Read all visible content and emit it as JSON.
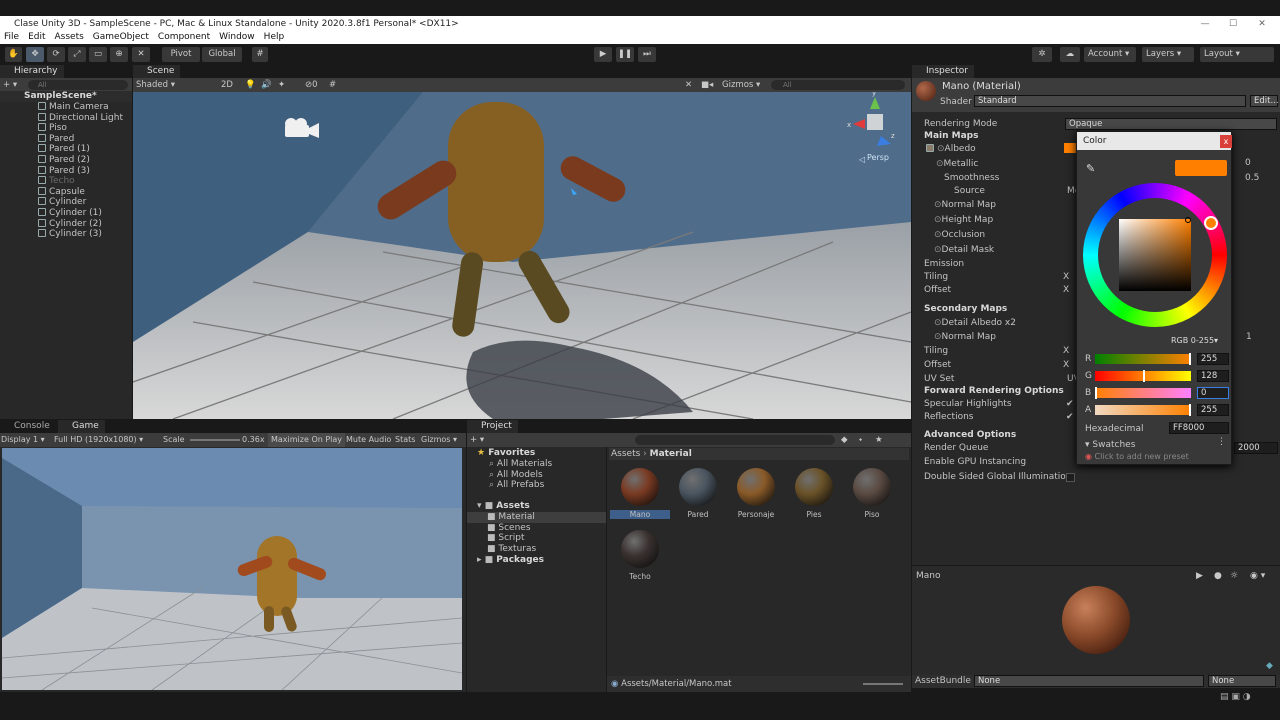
{
  "window": {
    "title": "Clase Unity 3D - SampleScene - PC, Mac & Linux Standalone - Unity 2020.3.8f1 Personal* <DX11>"
  },
  "menu": [
    "File",
    "Edit",
    "Assets",
    "GameObject",
    "Component",
    "Window",
    "Help"
  ],
  "toolbar": {
    "pivot": "Pivot",
    "global": "Global",
    "account": "Account",
    "layers": "Layers",
    "layout": "Layout"
  },
  "hierarchy": {
    "tab": "Hierarchy",
    "search_placeholder": "All",
    "scene": "SampleScene*",
    "items": [
      "Main Camera",
      "Directional Light",
      "Piso",
      "Pared",
      "Pared (1)",
      "Pared (2)",
      "Pared (3)",
      "Techo",
      "Capsule",
      "Cylinder",
      "Cylinder (1)",
      "Cylinder (2)",
      "Cylinder (3)"
    ]
  },
  "scene": {
    "tab": "Scene",
    "shading": "Shaded",
    "mode": "2D",
    "hidden_count": "0",
    "gizmos": "Gizmos",
    "search_placeholder": "All",
    "persp": "Persp"
  },
  "console_tab": "Console",
  "game": {
    "tab": "Game",
    "display": "Display 1",
    "resolution": "Full HD (1920x1080)",
    "scale_label": "Scale",
    "scale_value": "0.36x",
    "maximize": "Maximize On Play",
    "mute": "Mute Audio",
    "stats": "Stats",
    "gizmos": "Gizmos"
  },
  "project": {
    "tab": "Project",
    "favorites": "Favorites",
    "fav_items": [
      "All Materials",
      "All Models",
      "All Prefabs"
    ],
    "assets": "Assets",
    "asset_items": [
      "Material",
      "Scenes",
      "Script",
      "Texturas"
    ],
    "packages": "Packages",
    "breadcrumb_root": "Assets",
    "breadcrumb_leaf": "Material",
    "materials": [
      {
        "name": "Mano",
        "color": "#7a3a22"
      },
      {
        "name": "Pared",
        "color": "#4a5560"
      },
      {
        "name": "Personaje",
        "color": "#8a5a28"
      },
      {
        "name": "Pies",
        "color": "#6a5228"
      },
      {
        "name": "Piso",
        "color": "#5a4a42"
      },
      {
        "name": "Techo",
        "color": "#3a3230"
      }
    ],
    "footer_path": "Assets/Material/Mano.mat"
  },
  "inspector": {
    "tab": "Inspector",
    "title": "Mano (Material)",
    "shader_label": "Shader",
    "shader_value": "Standard",
    "edit": "Edit...",
    "rendering_mode_label": "Rendering Mode",
    "rendering_mode_value": "Opaque",
    "main_maps": "Main Maps",
    "albedo": "Albedo",
    "metallic": "Metallic",
    "metallic_value": "0",
    "smoothness": "Smoothness",
    "smoothness_value": "0.5",
    "source": "Source",
    "source_value": "Me",
    "normal_map": "Normal Map",
    "height_map": "Height Map",
    "occlusion": "Occlusion",
    "detail_mask": "Detail Mask",
    "emission": "Emission",
    "tiling": "Tiling",
    "offset": "Offset",
    "secondary_maps": "Secondary Maps",
    "detail_albedo": "Detail Albedo x2",
    "normal_map2": "Normal Map",
    "uv_value": "1",
    "tiling2": "Tiling",
    "offset2": "Offset",
    "uv_set": "UV Set",
    "uv_set_value": "UV",
    "forward_options": "Forward Rendering Options",
    "specular": "Specular Highlights",
    "reflections": "Reflections",
    "advanced": "Advanced Options",
    "render_queue": "Render Queue",
    "render_queue_value": "2000",
    "gpu_instancing": "Enable GPU Instancing",
    "double_sided": "Double Sided Global Illumination",
    "preview_name": "Mano",
    "assetbundle_label": "AssetBundle",
    "assetbundle_value": "None",
    "assetbundle_variant": "None",
    "x_label": "X"
  },
  "color_picker": {
    "title": "Color",
    "close": "x",
    "mode": "RGB 0-255",
    "r_label": "R",
    "r": "255",
    "g_label": "G",
    "g": "128",
    "b_label": "B",
    "b": "0",
    "a_label": "A",
    "a": "255",
    "hex_label": "Hexadecimal",
    "hex": "FF8000",
    "swatches": "Swatches",
    "preset_hint": "Click to add new preset",
    "current_color": "#ff8000"
  }
}
